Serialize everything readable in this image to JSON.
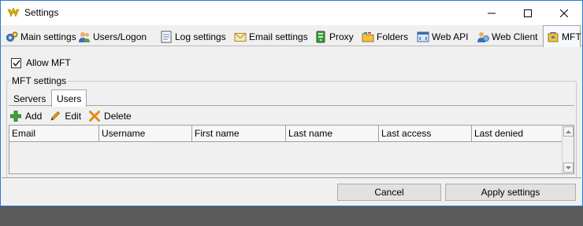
{
  "window": {
    "title": "Settings"
  },
  "tabs": [
    {
      "label": "Main settings",
      "icon": "gears-icon"
    },
    {
      "label": "Users/Logon",
      "icon": "users-icon"
    },
    {
      "label": "Log settings",
      "icon": "log-icon"
    },
    {
      "label": "Email settings",
      "icon": "envelope-icon"
    },
    {
      "label": "Proxy",
      "icon": "proxy-icon"
    },
    {
      "label": "Folders",
      "icon": "folders-icon"
    },
    {
      "label": "Web API",
      "icon": "web-api-icon"
    },
    {
      "label": "Web Client",
      "icon": "web-client-icon"
    },
    {
      "label": "MFT",
      "icon": "mft-icon",
      "active": true
    }
  ],
  "mft": {
    "allow_label": "Allow MFT",
    "allow_checked": true,
    "group_label": "MFT settings",
    "subtabs": [
      {
        "label": "Servers"
      },
      {
        "label": "Users",
        "active": true
      }
    ],
    "toolbar": {
      "add_label": "Add",
      "edit_label": "Edit",
      "delete_label": "Delete"
    },
    "grid": {
      "columns": [
        "Email",
        "Username",
        "First name",
        "Last name",
        "Last access",
        "Last denied"
      ],
      "rows": []
    }
  },
  "footer": {
    "cancel_label": "Cancel",
    "apply_label": "Apply settings"
  },
  "colors": {
    "window_border": "#2b7ad0",
    "add_icon": "#3aa53a",
    "delete_icon": "#e88a10",
    "edit_icon": "#f0a020"
  }
}
